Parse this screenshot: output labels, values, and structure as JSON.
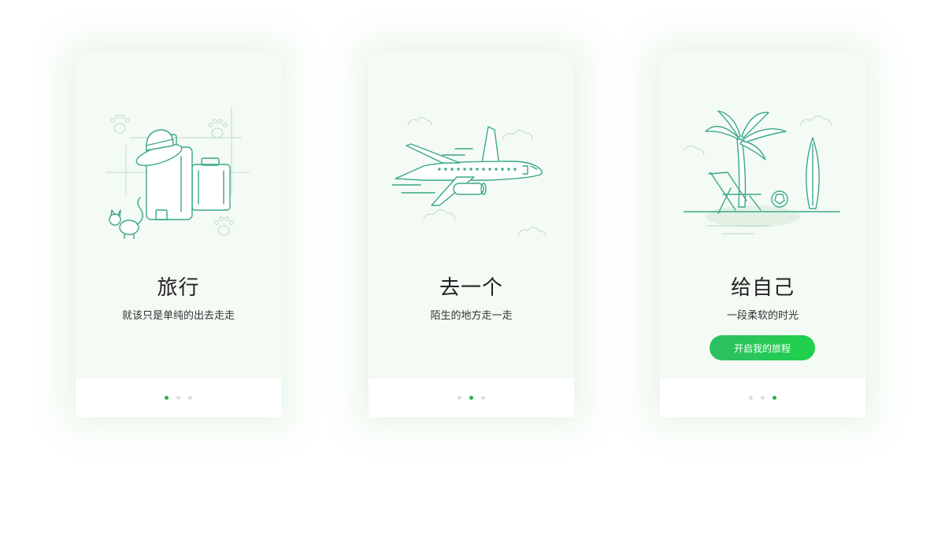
{
  "cards": [
    {
      "title": "旅行",
      "subtitle": "就该只是单纯的出去走走",
      "page_indicator": {
        "total": 3,
        "active": 1
      }
    },
    {
      "title": "去一个",
      "subtitle": "陌生的地方走一走",
      "page_indicator": {
        "total": 3,
        "active": 2
      }
    },
    {
      "title": "给自己",
      "subtitle": "一段柔软的时光",
      "button_label": "开启我的旅程",
      "page_indicator": {
        "total": 3,
        "active": 3
      }
    }
  ],
  "colors": {
    "accent": "#23b14d",
    "line": "#3aa88a",
    "card_bg": "#f4faf4",
    "dot_inactive": "#dedede"
  },
  "icons": [
    "luggage-illustration",
    "airplane-illustration",
    "beach-illustration"
  ]
}
